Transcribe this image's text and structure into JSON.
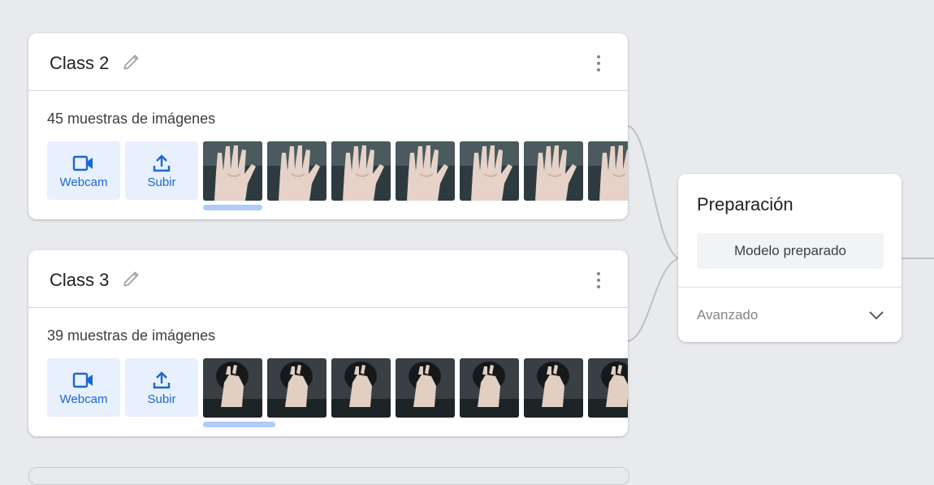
{
  "classes": [
    {
      "title": "Class 2",
      "count": "45 muestras de imágenes",
      "webcam": "Webcam",
      "upload": "Subir",
      "thumb_style": "palm",
      "progress": 0.14
    },
    {
      "title": "Class 3",
      "count": "39 muestras de imágenes",
      "webcam": "Webcam",
      "upload": "Subir",
      "thumb_style": "face",
      "progress": 0.17
    }
  ],
  "training": {
    "title": "Preparación",
    "button": "Modelo preparado",
    "advanced": "Avanzado"
  },
  "icons": {
    "edit": "pencil-icon",
    "menu": "more-vert-icon",
    "webcam": "videocam-icon",
    "upload": "upload-icon",
    "expand": "chevron-down-icon"
  },
  "colors": {
    "accent": "#1967d2",
    "button_bg": "#e8f0fe",
    "progress": "#aecbfa",
    "background": "#e8eaed"
  }
}
